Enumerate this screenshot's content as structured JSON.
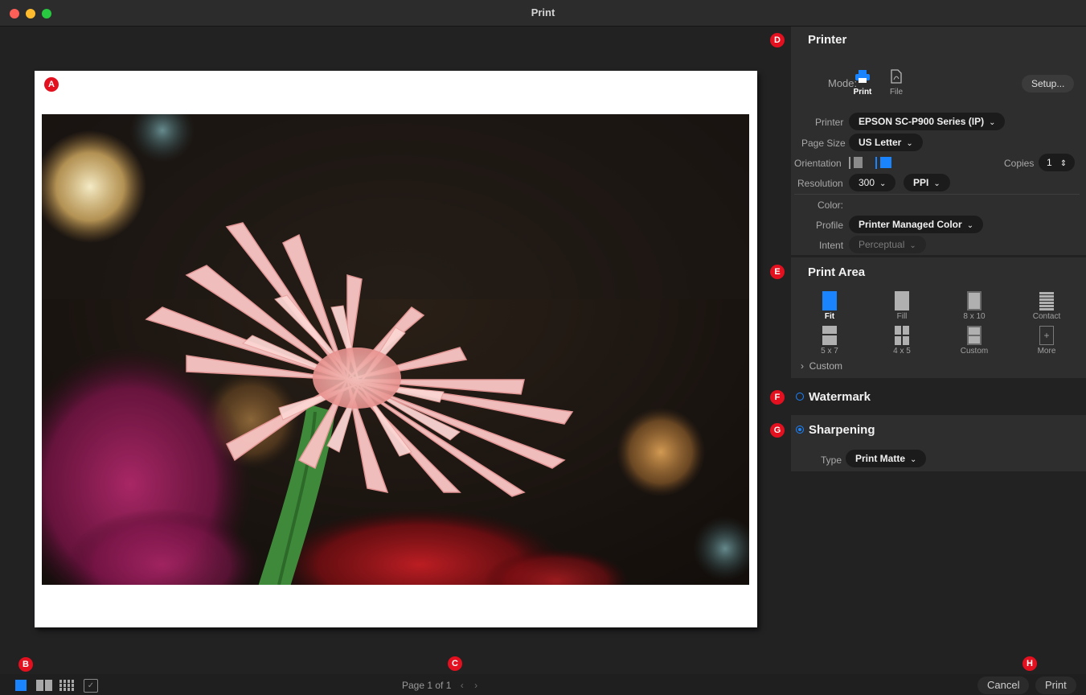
{
  "window": {
    "title": "Print"
  },
  "badges": {
    "a": "A",
    "b": "B",
    "c": "C",
    "d": "D",
    "e": "E",
    "f": "F",
    "g": "G",
    "h": "H"
  },
  "printer_panel": {
    "title": "Printer",
    "mode_label": "Mode:",
    "mode_print": "Print",
    "mode_file": "File",
    "setup_button": "Setup...",
    "printer_label": "Printer",
    "printer_value": "EPSON SC-P900 Series (IP)",
    "page_size_label": "Page Size",
    "page_size_value": "US Letter",
    "orientation_label": "Orientation",
    "copies_label": "Copies",
    "copies_value": "1",
    "resolution_label": "Resolution",
    "resolution_value": "300",
    "resolution_unit": "PPI",
    "color_label": "Color:",
    "profile_label": "Profile",
    "profile_value": "Printer Managed Color",
    "intent_label": "Intent",
    "intent_value": "Perceptual"
  },
  "print_area": {
    "title": "Print Area",
    "items": [
      "Fit",
      "Fill",
      "8 x 10",
      "Contact",
      "5 x 7",
      "4 x 5",
      "Custom",
      "More"
    ],
    "selected": "Fit",
    "custom_toggle": "Custom"
  },
  "watermark": {
    "title": "Watermark"
  },
  "sharpening": {
    "title": "Sharpening",
    "type_label": "Type",
    "type_value": "Print Matte"
  },
  "footer": {
    "page_info": "Page 1 of 1",
    "cancel": "Cancel",
    "print": "Print"
  },
  "colors": {
    "accent": "#1a84ff",
    "badge": "#e3101f"
  }
}
